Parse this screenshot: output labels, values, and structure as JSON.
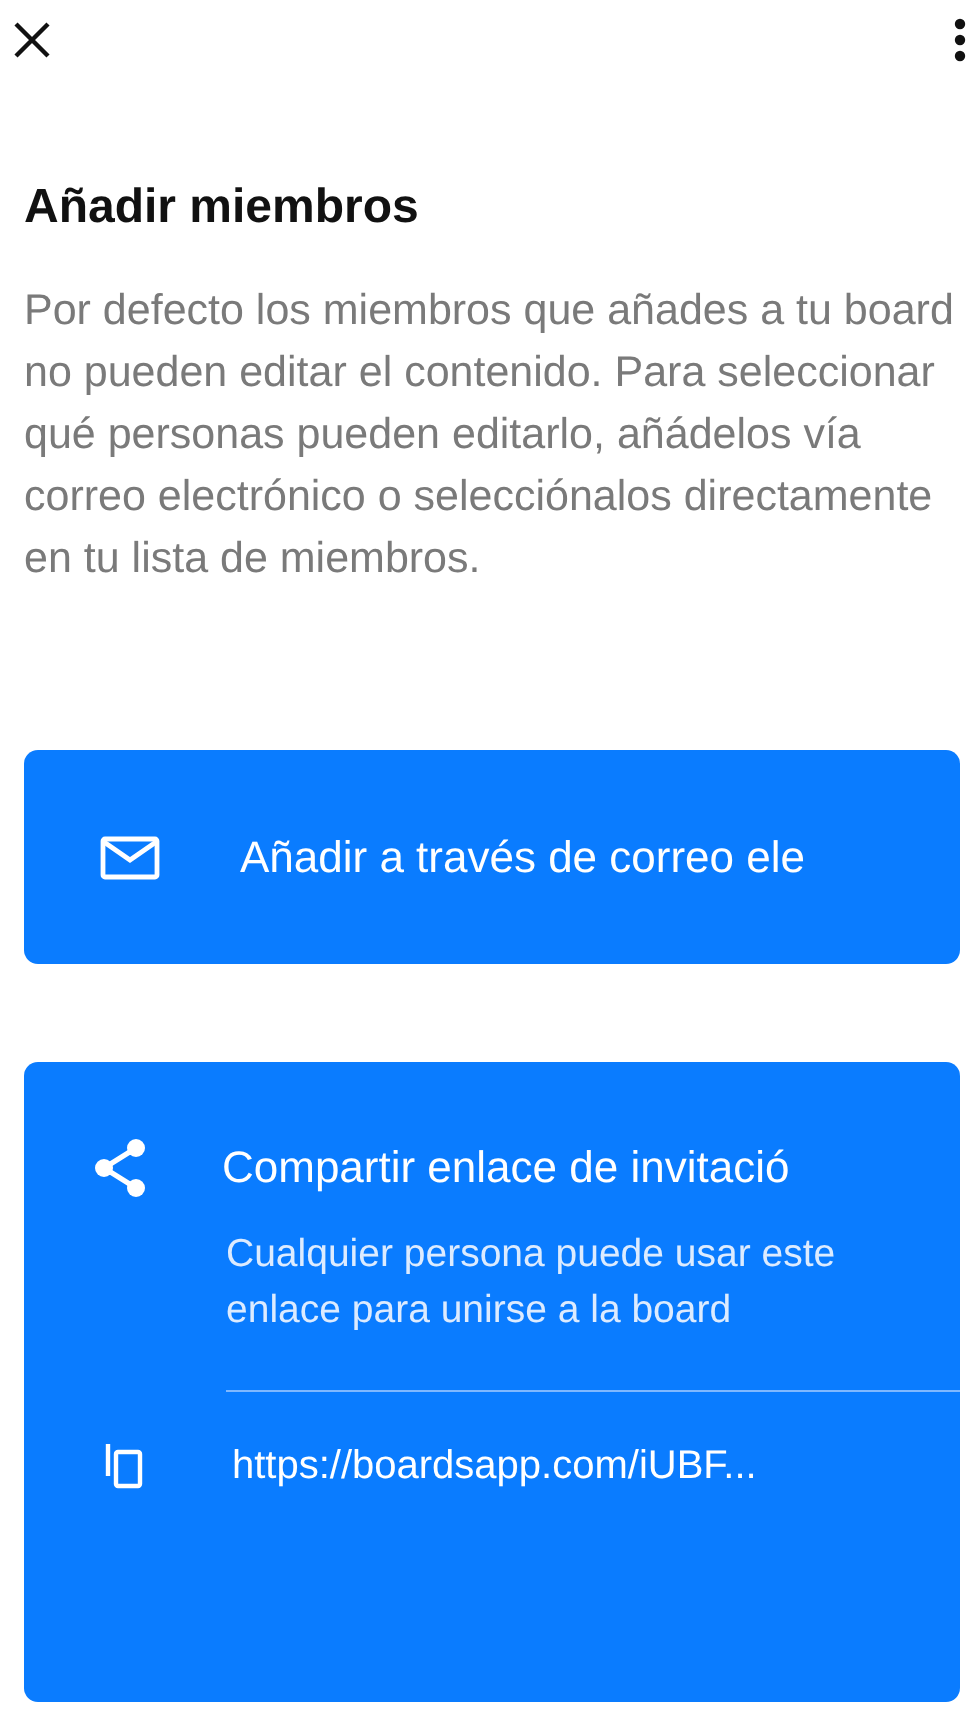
{
  "title": "Añadir miembros",
  "description": "Por defecto los miembros que añades a tu board no pueden editar el contenido. Para seleccionar qué personas pueden editarlo, añádelos vía correo electrónico o selecciónalos directamente en tu lista de miembros.",
  "email_option": {
    "label": "Añadir a través de correo ele"
  },
  "invite_option": {
    "label": "Compartir enlace de invitació",
    "description": "Cualquier persona puede usar este enlace para unirse a la board",
    "link": "https://boardsapp.com/iUBF..."
  }
}
